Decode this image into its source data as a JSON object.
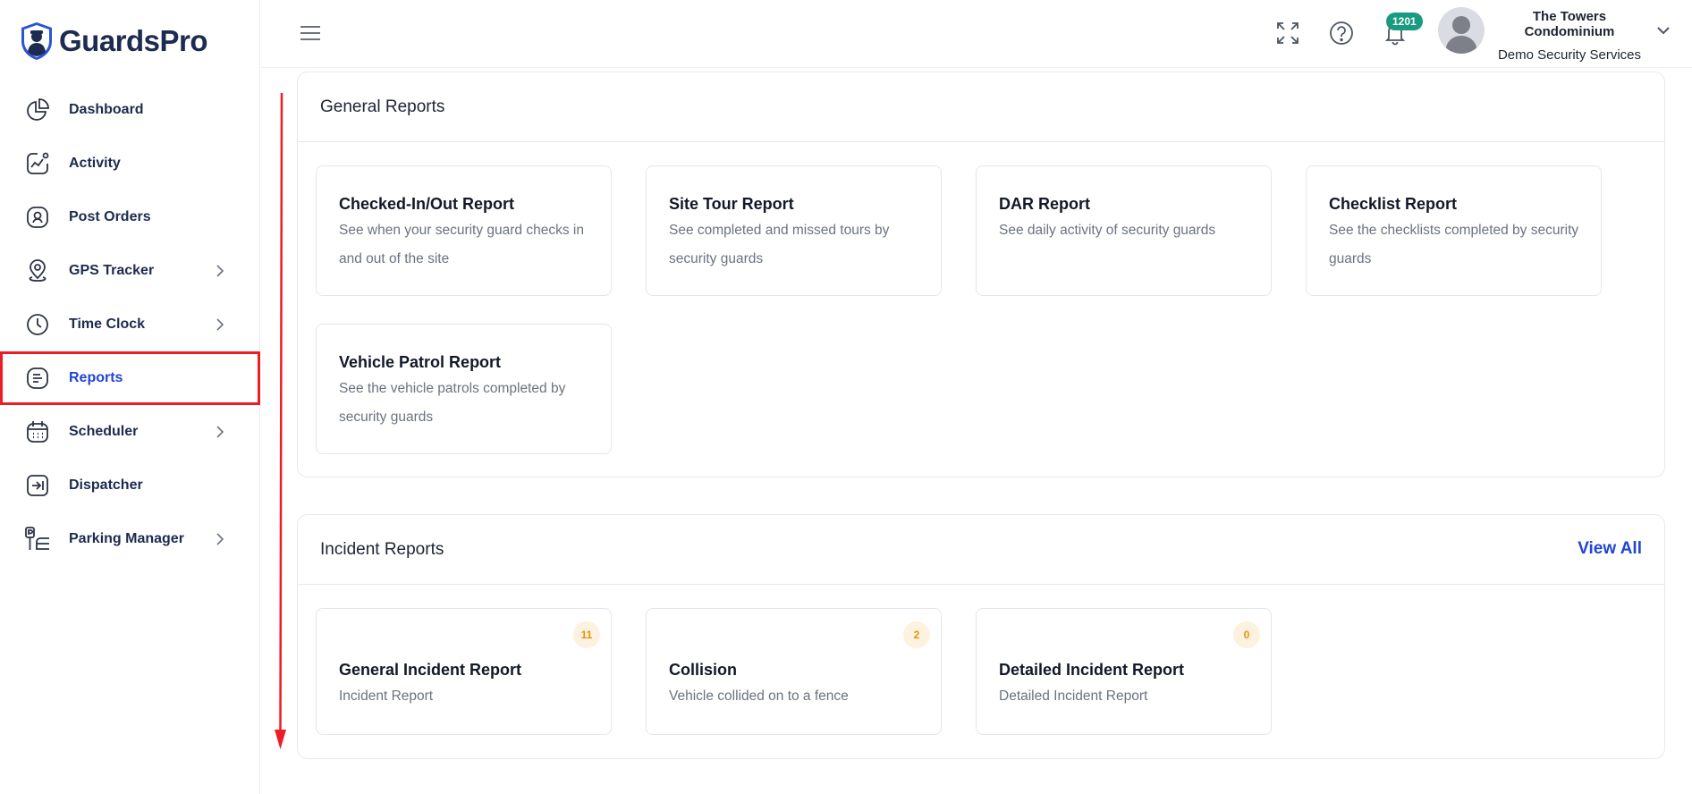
{
  "brand": {
    "name": "GuardsPro"
  },
  "sidebar": {
    "items": [
      {
        "label": "Dashboard",
        "icon": "pie-chart-icon",
        "has_submenu": false
      },
      {
        "label": "Activity",
        "icon": "activity-chart-icon",
        "has_submenu": false
      },
      {
        "label": "Post Orders",
        "icon": "post-orders-icon",
        "has_submenu": false
      },
      {
        "label": "GPS Tracker",
        "icon": "location-pin-icon",
        "has_submenu": true
      },
      {
        "label": "Time Clock",
        "icon": "clock-icon",
        "has_submenu": true
      },
      {
        "label": "Reports",
        "icon": "report-document-icon",
        "has_submenu": false,
        "active": true
      },
      {
        "label": "Scheduler",
        "icon": "calendar-icon",
        "has_submenu": true
      },
      {
        "label": "Dispatcher",
        "icon": "dispatch-icon",
        "has_submenu": false
      },
      {
        "label": "Parking Manager",
        "icon": "parking-icon",
        "has_submenu": true
      }
    ]
  },
  "topbar": {
    "notifications_count": "1201",
    "user": {
      "name": "The Towers Condominium",
      "org": "Demo Security Services"
    }
  },
  "general_reports": {
    "title": "General Reports",
    "cards": [
      {
        "title": "Checked-In/Out Report",
        "desc": "See when your security guard checks in and out of the site"
      },
      {
        "title": "Site Tour Report",
        "desc": "See completed and missed tours by security guards"
      },
      {
        "title": "DAR Report",
        "desc": "See daily activity of security guards"
      },
      {
        "title": "Checklist Report",
        "desc": "See the checklists completed by security guards"
      },
      {
        "title": "Vehicle Patrol Report",
        "desc": "See the vehicle patrols completed by security guards"
      }
    ]
  },
  "incident_reports": {
    "title": "Incident Reports",
    "view_all": "View All",
    "cards": [
      {
        "title": "General Incident Report",
        "desc": "Incident Report",
        "count": "11"
      },
      {
        "title": "Collision",
        "desc": "Vehicle collided on to a fence",
        "count": "2"
      },
      {
        "title": "Detailed Incident Report",
        "desc": "Detailed Incident Report",
        "count": "0"
      }
    ]
  },
  "colors": {
    "brand_navy": "#1c2b4f",
    "active_blue": "#2144d8",
    "highlight_red": "#ee1c25",
    "badge_teal": "#1a9a80",
    "count_orange": "#e8910c"
  }
}
